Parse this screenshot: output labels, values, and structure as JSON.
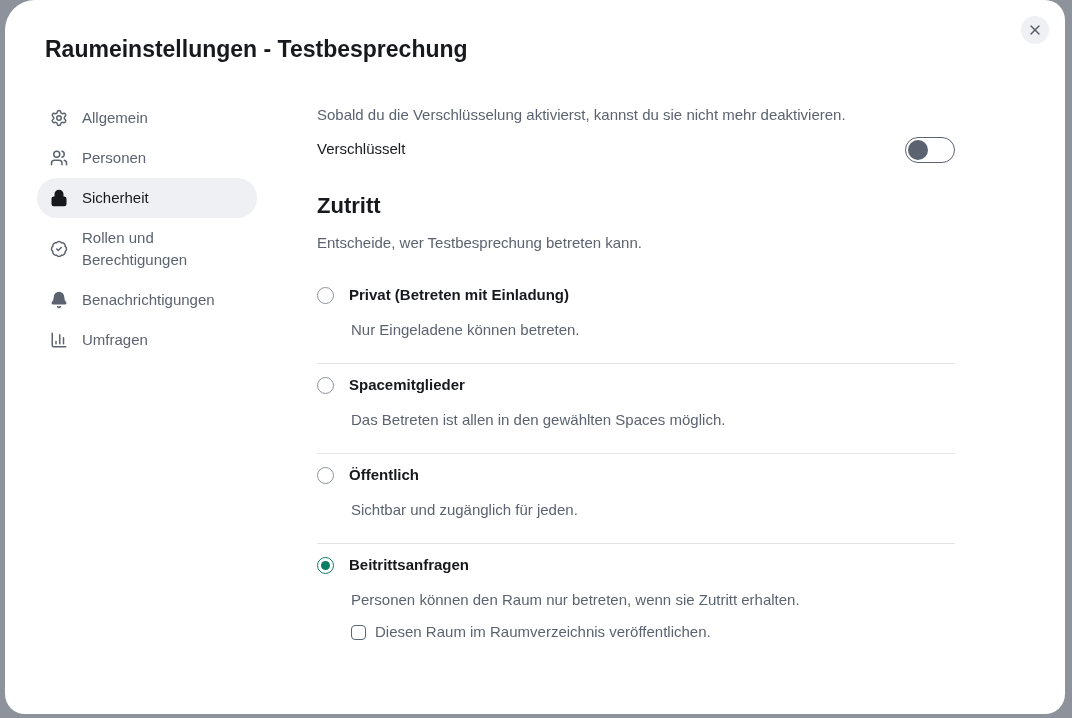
{
  "dialog": {
    "title": "Raumeinstellungen - Testbesprechung"
  },
  "sidebar": {
    "items": [
      {
        "label": "Allgemein",
        "selected": false
      },
      {
        "label": "Personen",
        "selected": false
      },
      {
        "label": "Sicherheit",
        "selected": true
      },
      {
        "label": "Rollen und Berechtigungen",
        "selected": false
      },
      {
        "label": "Benachrichtigungen",
        "selected": false
      },
      {
        "label": "Umfragen",
        "selected": false
      }
    ]
  },
  "encryption": {
    "note": "Sobald du die Verschlüsselung aktivierst, kannst du sie nicht mehr deaktivieren.",
    "label": "Verschlüsselt",
    "on": false
  },
  "access": {
    "heading": "Zutritt",
    "description": "Entscheide, wer Testbesprechung betreten kann.",
    "options": [
      {
        "label": "Privat (Betreten mit Einladung)",
        "description": "Nur Eingeladene können betreten.",
        "selected": false
      },
      {
        "label": "Spacemitglieder",
        "description": "Das Betreten ist allen in den gewählten Spaces möglich.",
        "selected": false
      },
      {
        "label": "Öffentlich",
        "description": "Sichtbar und zugänglich für jeden.",
        "selected": false
      },
      {
        "label": "Beitrittsanfragen",
        "description": "Personen können den Raum nur betreten, wenn sie Zutritt erhalten.",
        "selected": true,
        "checkbox": {
          "label": "Diesen Raum im Raumverzeichnis veröffentlichen.",
          "checked": false
        }
      }
    ]
  }
}
